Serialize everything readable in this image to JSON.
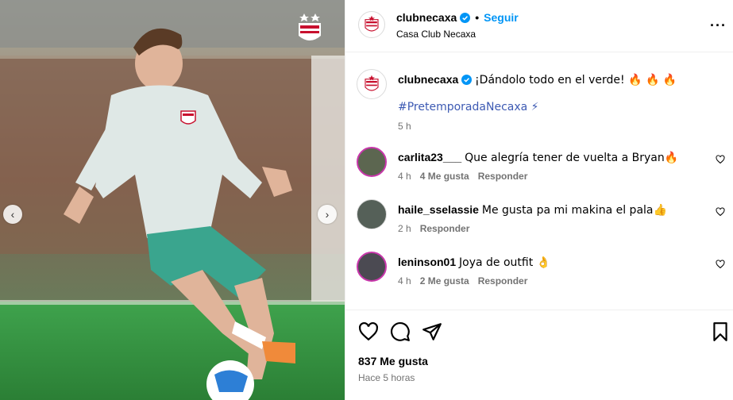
{
  "post": {
    "username": "clubnecaxa",
    "follow_label": "Seguir",
    "separator": "•",
    "location": "Casa Club Necaxa",
    "more_label": "···",
    "media_description_icon": "player-photo"
  },
  "caption": {
    "username": "clubnecaxa",
    "text": "¡Dándolo todo en el verde! 🔥 🔥 🔥",
    "hashtag": "#PretemporadaNecaxa ⚡",
    "time": "5 h"
  },
  "comments": [
    {
      "username": "carlita23___",
      "text": "Que alegría tener de vuelta a Bryan🔥",
      "time": "4 h",
      "likes": "4 Me gusta",
      "reply": "Responder"
    },
    {
      "username": "haile_sselassie",
      "text": "Me gusta pa mi makina el pala👍",
      "time": "2 h",
      "likes": "",
      "reply": "Responder"
    },
    {
      "username": "leninson01",
      "text": "Joya de outfit 👌",
      "time": "4 h",
      "likes": "2 Me gusta",
      "reply": "Responder"
    }
  ],
  "footer": {
    "likes": "837 Me gusta",
    "time_ago": "Hace 5 horas"
  },
  "colors": {
    "link": "#0095f6",
    "hashtag": "#3d5ab3",
    "muted": "#737373",
    "club_red": "#c8102e"
  }
}
